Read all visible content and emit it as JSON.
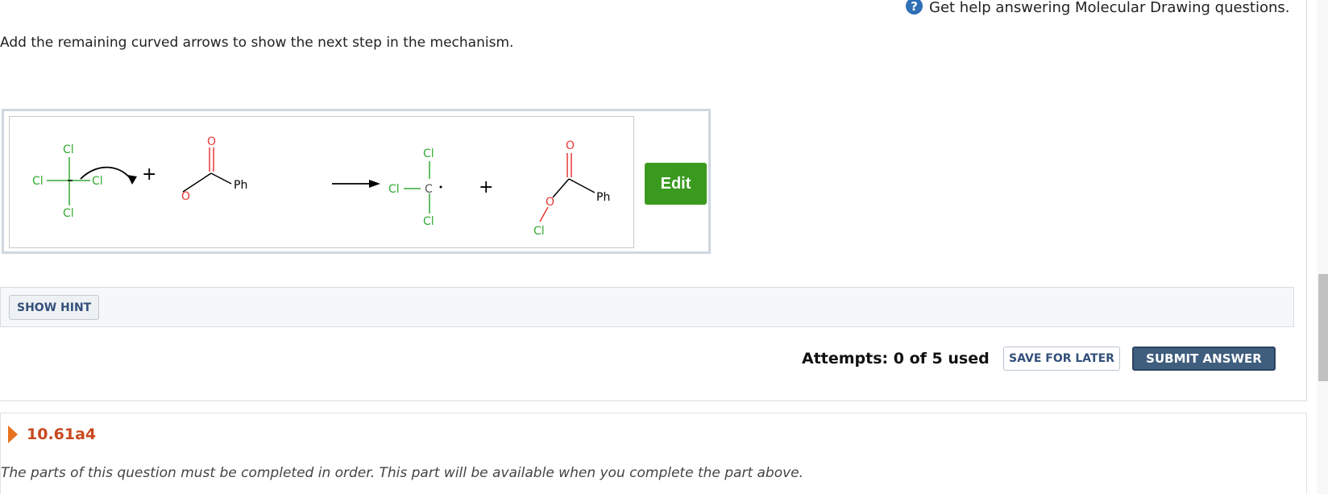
{
  "help": {
    "icon": "question-icon",
    "icon_glyph": "?",
    "text": "Get help answering Molecular Drawing questions."
  },
  "question": {
    "prompt": "Add the remaining curved arrows to show the next step in the mechanism."
  },
  "drawing": {
    "atoms": {
      "cl": "Cl",
      "o": "O",
      "ph": "Ph",
      "c": "C",
      "plus": "+"
    },
    "edit_label": "Edit"
  },
  "hint": {
    "button_label": "SHOW HINT"
  },
  "submission": {
    "attempts_text": "Attempts: 0 of 5 used",
    "save_label": "SAVE FOR LATER",
    "submit_label": "SUBMIT ANSWER"
  },
  "next_part": {
    "title": "10.61a4",
    "note": "The parts of this question must be completed in order. This part will be available when you complete the part above."
  },
  "colors": {
    "chlorine": "#33aa33",
    "oxygen": "#e53935",
    "edit": "#3a9a1f",
    "submit": "#3f5d7d",
    "part_title": "#c8481e",
    "triangle": "#e8731e"
  }
}
